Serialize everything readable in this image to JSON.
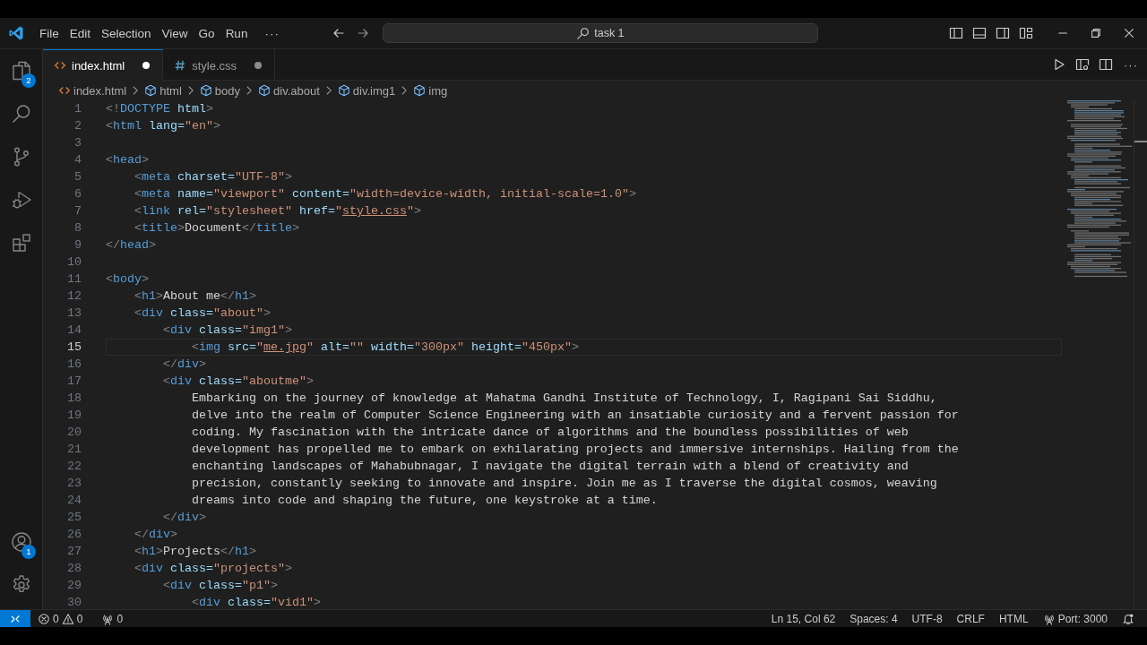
{
  "title_bar": {
    "menu": [
      "File",
      "Edit",
      "Selection",
      "View",
      "Go",
      "Run"
    ],
    "more": "···",
    "search": "task 1"
  },
  "activity_bar": {
    "top": [
      {
        "kind": "explorer",
        "badge": "2"
      },
      {
        "kind": "search"
      },
      {
        "kind": "source-control"
      },
      {
        "kind": "run-debug"
      },
      {
        "kind": "extensions"
      }
    ],
    "bottom": [
      {
        "kind": "accounts",
        "badge": "1"
      },
      {
        "kind": "settings"
      }
    ]
  },
  "tabs": [
    {
      "label": "index.html",
      "kind": "html",
      "selected": true,
      "modified": true
    },
    {
      "label": "style.css",
      "kind": "css",
      "selected": false,
      "modified": true
    }
  ],
  "editor_actions": {
    "more": "···"
  },
  "breadcrumb": [
    {
      "label": "index.html",
      "kind": "file"
    },
    {
      "label": "html",
      "kind": "element"
    },
    {
      "label": "body",
      "kind": "element"
    },
    {
      "label": "div.about",
      "kind": "element"
    },
    {
      "label": "div.img1",
      "kind": "element"
    },
    {
      "label": "img",
      "kind": "element"
    }
  ],
  "editor": {
    "lines": [
      {
        "number": "1",
        "current": false,
        "tokens": [
          {
            "kind": "punct",
            "text": "<!"
          },
          {
            "kind": "tag",
            "text": "DOCTYPE"
          },
          {
            "kind": "attr",
            "text": " html"
          },
          {
            "kind": "punct",
            "text": ">"
          }
        ]
      },
      {
        "number": "2",
        "current": false,
        "tokens": [
          {
            "kind": "punct",
            "text": "<"
          },
          {
            "kind": "tag",
            "text": "html"
          },
          {
            "kind": "attr",
            "text": " lang="
          },
          {
            "kind": "string",
            "text": "\"en\""
          },
          {
            "kind": "punct",
            "text": ">"
          }
        ]
      },
      {
        "number": "3",
        "current": false
      },
      {
        "number": "4",
        "current": false,
        "tokens": [
          {
            "kind": "punct",
            "text": "<"
          },
          {
            "kind": "tag",
            "text": "head"
          },
          {
            "kind": "punct",
            "text": ">"
          }
        ]
      },
      {
        "number": "5",
        "current": false,
        "tokens": [
          {
            "kind": "punct",
            "text": "    <"
          },
          {
            "kind": "tag",
            "text": "meta"
          },
          {
            "kind": "attr",
            "text": " charset="
          },
          {
            "kind": "string",
            "text": "\"UTF-8\""
          },
          {
            "kind": "punct",
            "text": ">"
          }
        ]
      },
      {
        "number": "6",
        "current": false,
        "tokens": [
          {
            "kind": "punct",
            "text": "    <"
          },
          {
            "kind": "tag",
            "text": "meta"
          },
          {
            "kind": "attr",
            "text": " name="
          },
          {
            "kind": "string",
            "text": "\"viewport\""
          },
          {
            "kind": "attr",
            "text": " content="
          },
          {
            "kind": "string",
            "text": "\"width=device-width, initial-scale=1.0\""
          },
          {
            "kind": "punct",
            "text": ">"
          }
        ]
      },
      {
        "number": "7",
        "current": false,
        "tokens": [
          {
            "kind": "punct",
            "text": "    <"
          },
          {
            "kind": "tag",
            "text": "link"
          },
          {
            "kind": "attr",
            "text": " rel="
          },
          {
            "kind": "string",
            "text": "\"stylesheet\""
          },
          {
            "kind": "attr",
            "text": " href="
          },
          {
            "kind": "string",
            "text": "\""
          },
          {
            "kind": "link",
            "text": "style.css"
          },
          {
            "kind": "string",
            "text": "\""
          },
          {
            "kind": "punct",
            "text": ">"
          }
        ]
      },
      {
        "number": "8",
        "current": false,
        "tokens": [
          {
            "kind": "punct",
            "text": "    <"
          },
          {
            "kind": "tag",
            "text": "title"
          },
          {
            "kind": "punct",
            "text": ">"
          },
          {
            "kind": "text",
            "text": "Document"
          },
          {
            "kind": "punct",
            "text": "</"
          },
          {
            "kind": "tag",
            "text": "title"
          },
          {
            "kind": "punct",
            "text": ">"
          }
        ]
      },
      {
        "number": "9",
        "current": false,
        "tokens": [
          {
            "kind": "punct",
            "text": "</"
          },
          {
            "kind": "tag",
            "text": "head"
          },
          {
            "kind": "punct",
            "text": ">"
          }
        ]
      },
      {
        "number": "10",
        "current": false
      },
      {
        "number": "11",
        "current": false,
        "tokens": [
          {
            "kind": "punct",
            "text": "<"
          },
          {
            "kind": "tag",
            "text": "body"
          },
          {
            "kind": "punct",
            "text": ">"
          }
        ]
      },
      {
        "number": "12",
        "current": false,
        "tokens": [
          {
            "kind": "punct",
            "text": "    <"
          },
          {
            "kind": "tag",
            "text": "h1"
          },
          {
            "kind": "punct",
            "text": ">"
          },
          {
            "kind": "text",
            "text": "About me"
          },
          {
            "kind": "punct",
            "text": "</"
          },
          {
            "kind": "tag",
            "text": "h1"
          },
          {
            "kind": "punct",
            "text": ">"
          }
        ]
      },
      {
        "number": "13",
        "current": false,
        "tokens": [
          {
            "kind": "punct",
            "text": "    <"
          },
          {
            "kind": "tag",
            "text": "div"
          },
          {
            "kind": "attr",
            "text": " class="
          },
          {
            "kind": "string",
            "text": "\"about\""
          },
          {
            "kind": "punct",
            "text": ">"
          }
        ]
      },
      {
        "number": "14",
        "current": false,
        "tokens": [
          {
            "kind": "punct",
            "text": "        <"
          },
          {
            "kind": "tag",
            "text": "div"
          },
          {
            "kind": "attr",
            "text": " class="
          },
          {
            "kind": "string",
            "text": "\"img1\""
          },
          {
            "kind": "punct",
            "text": ">"
          }
        ]
      },
      {
        "number": "15",
        "current": true,
        "tokens": [
          {
            "kind": "punct",
            "text": "            <"
          },
          {
            "kind": "tag",
            "text": "img"
          },
          {
            "kind": "attr",
            "text": " src="
          },
          {
            "kind": "string",
            "text": "\""
          },
          {
            "kind": "link",
            "text": "me.jpg"
          },
          {
            "kind": "string",
            "text": "\""
          },
          {
            "kind": "attr",
            "text": " alt="
          },
          {
            "kind": "string",
            "text": "\"\""
          },
          {
            "kind": "attr",
            "text": " width="
          },
          {
            "kind": "string",
            "text": "\"300px\""
          },
          {
            "kind": "attr",
            "text": " height="
          },
          {
            "kind": "string",
            "text": "\"450px\""
          },
          {
            "kind": "punct",
            "text": ">"
          }
        ]
      },
      {
        "number": "16",
        "current": false,
        "tokens": [
          {
            "kind": "punct",
            "text": "        </"
          },
          {
            "kind": "tag",
            "text": "div"
          },
          {
            "kind": "punct",
            "text": ">"
          }
        ]
      },
      {
        "number": "17",
        "current": false,
        "tokens": [
          {
            "kind": "punct",
            "text": "        <"
          },
          {
            "kind": "tag",
            "text": "div"
          },
          {
            "kind": "attr",
            "text": " class="
          },
          {
            "kind": "string",
            "text": "\"aboutme\""
          },
          {
            "kind": "punct",
            "text": ">"
          }
        ]
      },
      {
        "number": "18",
        "current": false,
        "tokens": [
          {
            "kind": "text",
            "text": "            Embarking on the journey of knowledge at Mahatma Gandhi Institute of Technology, I, Ragipani Sai Siddhu,"
          }
        ]
      },
      {
        "number": "19",
        "current": false,
        "tokens": [
          {
            "kind": "text",
            "text": "            delve into the realm of Computer Science Engineering with an insatiable curiosity and a fervent passion for"
          }
        ]
      },
      {
        "number": "20",
        "current": false,
        "tokens": [
          {
            "kind": "text",
            "text": "            coding. My fascination with the intricate dance of algorithms and the boundless possibilities of web"
          }
        ]
      },
      {
        "number": "21",
        "current": false,
        "tokens": [
          {
            "kind": "text",
            "text": "            development has propelled me to embark on exhilarating projects and immersive internships. Hailing from the"
          }
        ]
      },
      {
        "number": "22",
        "current": false,
        "tokens": [
          {
            "kind": "text",
            "text": "            enchanting landscapes of Mahabubnagar, I navigate the digital terrain with a blend of creativity and"
          }
        ]
      },
      {
        "number": "23",
        "current": false,
        "tokens": [
          {
            "kind": "text",
            "text": "            precision, constantly seeking to innovate and inspire. Join me as I traverse the digital cosmos, weaving"
          }
        ]
      },
      {
        "number": "24",
        "current": false,
        "tokens": [
          {
            "kind": "text",
            "text": "            dreams into code and shaping the future, one keystroke at a time."
          }
        ]
      },
      {
        "number": "25",
        "current": false,
        "tokens": [
          {
            "kind": "punct",
            "text": "        </"
          },
          {
            "kind": "tag",
            "text": "div"
          },
          {
            "kind": "punct",
            "text": ">"
          }
        ]
      },
      {
        "number": "26",
        "current": false,
        "tokens": [
          {
            "kind": "punct",
            "text": "    </"
          },
          {
            "kind": "tag",
            "text": "div"
          },
          {
            "kind": "punct",
            "text": ">"
          }
        ]
      },
      {
        "number": "27",
        "current": false,
        "tokens": [
          {
            "kind": "punct",
            "text": "    <"
          },
          {
            "kind": "tag",
            "text": "h1"
          },
          {
            "kind": "punct",
            "text": ">"
          },
          {
            "kind": "text",
            "text": "Projects"
          },
          {
            "kind": "punct",
            "text": "</"
          },
          {
            "kind": "tag",
            "text": "h1"
          },
          {
            "kind": "punct",
            "text": ">"
          }
        ]
      },
      {
        "number": "28",
        "current": false,
        "tokens": [
          {
            "kind": "punct",
            "text": "    <"
          },
          {
            "kind": "tag",
            "text": "div"
          },
          {
            "kind": "attr",
            "text": " class="
          },
          {
            "kind": "string",
            "text": "\"projects\""
          },
          {
            "kind": "punct",
            "text": ">"
          }
        ]
      },
      {
        "number": "29",
        "current": false,
        "tokens": [
          {
            "kind": "punct",
            "text": "        <"
          },
          {
            "kind": "tag",
            "text": "div"
          },
          {
            "kind": "attr",
            "text": " class="
          },
          {
            "kind": "string",
            "text": "\"p1\""
          },
          {
            "kind": "punct",
            "text": ">"
          }
        ]
      },
      {
        "number": "30",
        "current": false,
        "tokens": [
          {
            "kind": "punct",
            "text": "            <"
          },
          {
            "kind": "tag",
            "text": "div"
          },
          {
            "kind": "attr",
            "text": " class="
          },
          {
            "kind": "string",
            "text": "\"vid1\""
          },
          {
            "kind": "punct",
            "text": ">"
          }
        ]
      }
    ]
  },
  "status_bar": {
    "errors": "0",
    "warnings": "0",
    "ports": "0",
    "items": [
      {
        "kind": "text",
        "text": "Ln 15, Col 62"
      },
      {
        "kind": "text",
        "text": "Spaces: 4"
      },
      {
        "kind": "text",
        "text": "UTF-8"
      },
      {
        "kind": "text",
        "text": "CRLF"
      },
      {
        "kind": "text",
        "text": "HTML"
      },
      {
        "kind": "port",
        "text": "Port: 3000"
      }
    ]
  }
}
